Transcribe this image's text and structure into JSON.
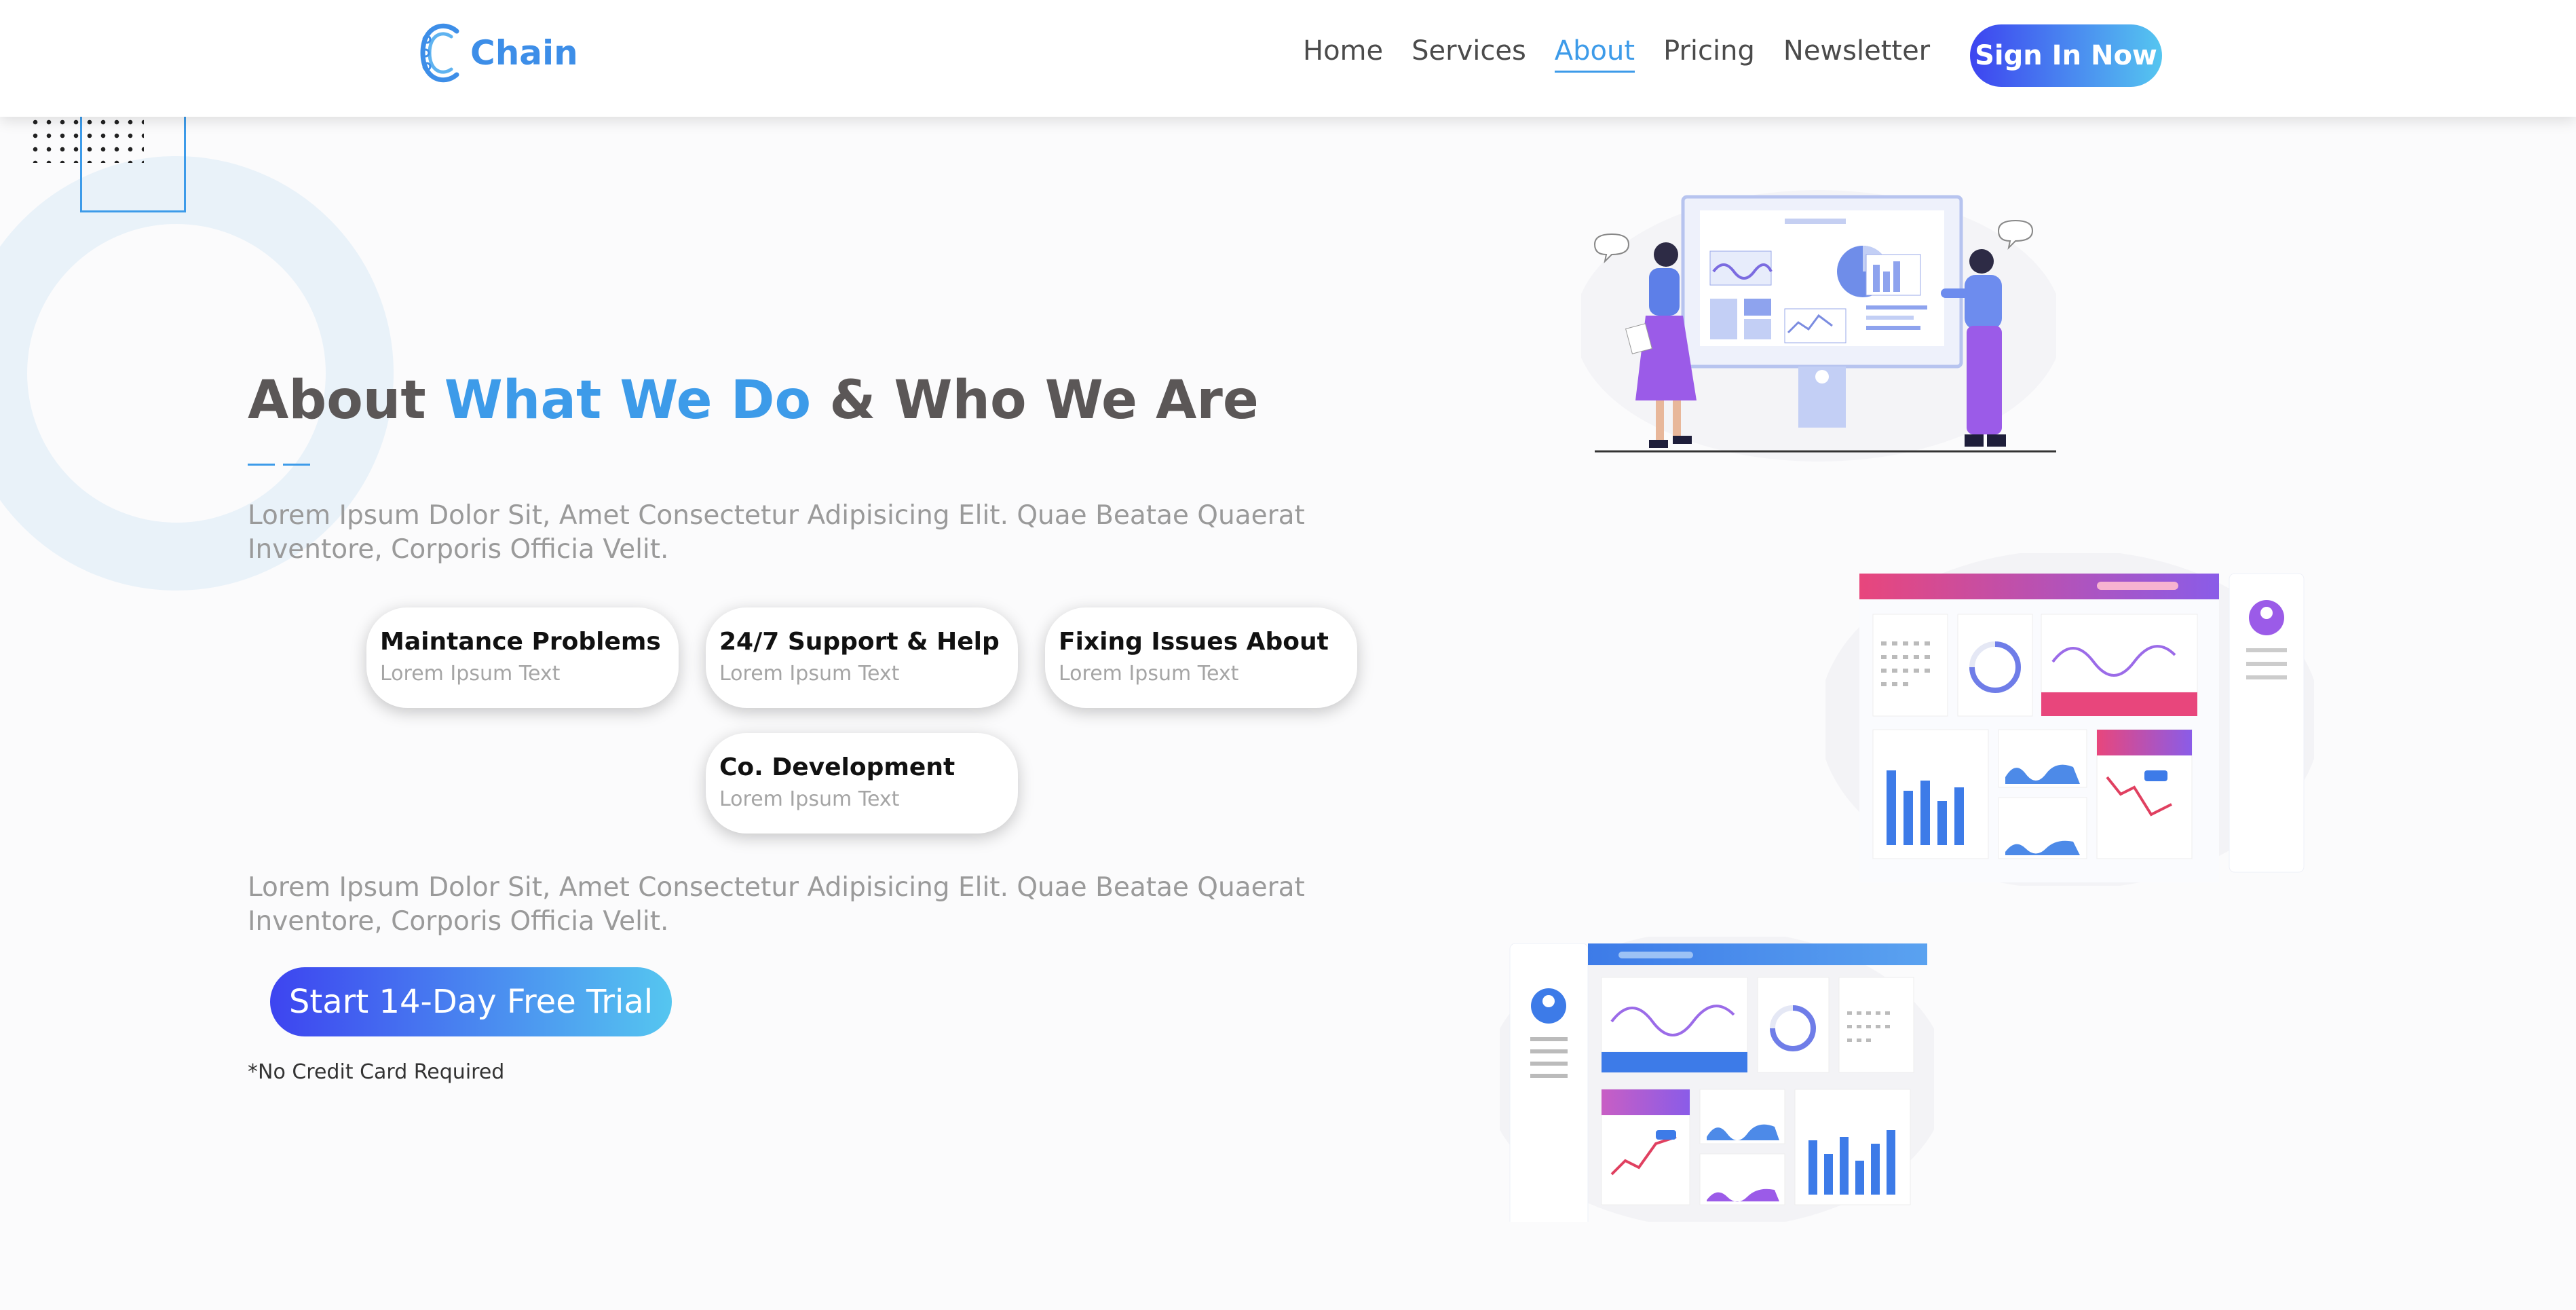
{
  "brand": {
    "name": "Chain",
    "color": "#3d8ee8"
  },
  "nav": {
    "items": [
      {
        "label": "Home"
      },
      {
        "label": "Services"
      },
      {
        "label": "About",
        "active": true
      },
      {
        "label": "Pricing"
      },
      {
        "label": "Newsletter"
      }
    ],
    "signin_label": "Sign In Now"
  },
  "hero": {
    "title_part1": "About ",
    "title_highlight": "What We Do",
    "title_part2": " & Who We Are",
    "paragraph1": "Lorem Ipsum Dolor Sit, Amet Consectetur Adipisicing Elit. Quae Beatae Quaerat Inventore, Corporis Officia Velit.",
    "paragraph2": "Lorem Ipsum Dolor Sit, Amet Consectetur Adipisicing Elit. Quae Beatae Quaerat Inventore, Corporis Officia Velit.",
    "cards": [
      {
        "title": "Maintance Problems",
        "subtitle": "Lorem Ipsum Text"
      },
      {
        "title": "24/7 Support & Help",
        "subtitle": "Lorem Ipsum Text"
      },
      {
        "title": "Fixing Issues About",
        "subtitle": "Lorem Ipsum Text"
      },
      {
        "title": "Co. Development",
        "subtitle": "Lorem Ipsum Text"
      }
    ],
    "cta_label": "Start 14-Day Free Trial",
    "cta_note": "*No Credit Card Required"
  },
  "colors": {
    "accent": "#3d9be9",
    "gradient_start": "#3d44f0",
    "gradient_end": "#55c6f0",
    "heading": "#5b5757"
  },
  "icons": [
    "chain-logo-icon",
    "people-dashboard-illustration",
    "dashboard-screenshot-1",
    "dashboard-screenshot-2"
  ]
}
